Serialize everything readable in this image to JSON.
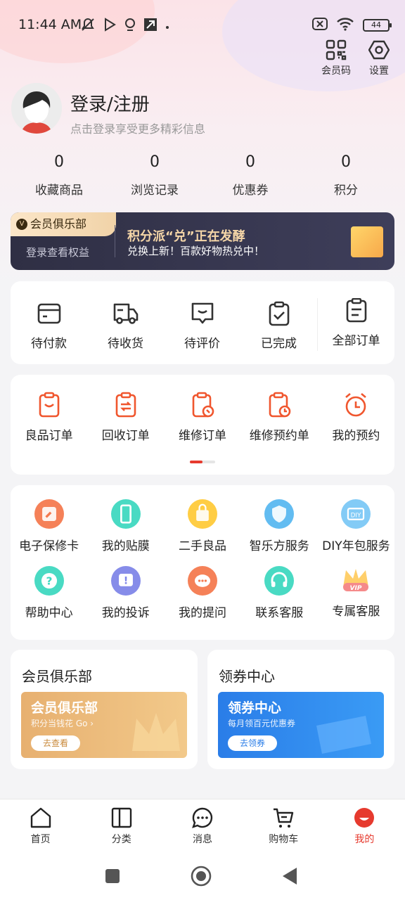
{
  "status": {
    "time": "11:44 AM",
    "battery": "44"
  },
  "top_buttons": {
    "member_code": "会员码",
    "settings": "设置"
  },
  "profile": {
    "title": "登录/注册",
    "subtitle": "点击登录享受更多精彩信息"
  },
  "stats": [
    {
      "value": "0",
      "label": "收藏商品"
    },
    {
      "value": "0",
      "label": "浏览记录"
    },
    {
      "value": "0",
      "label": "优惠券"
    },
    {
      "value": "0",
      "label": "积分"
    }
  ],
  "vip_banner": {
    "tag": "会员俱乐部",
    "see_benefits": "登录查看权益",
    "headline": "积分派“兑”正在发酵",
    "subline": "兑换上新！百款好物热兑中！"
  },
  "orders": [
    {
      "label": "待付款",
      "icon": "wallet-icon"
    },
    {
      "label": "待收货",
      "icon": "truck-icon"
    },
    {
      "label": "待评价",
      "icon": "comment-icon"
    },
    {
      "label": "已完成",
      "icon": "clipboard-check-icon"
    },
    {
      "label": "全部订单",
      "icon": "clipboard-list-icon"
    }
  ],
  "services": [
    {
      "label": "良品订单",
      "icon": "bag-order-icon"
    },
    {
      "label": "回收订单",
      "icon": "recycle-order-icon"
    },
    {
      "label": "维修订单",
      "icon": "repair-order-icon"
    },
    {
      "label": "维修预约单",
      "icon": "repair-booking-icon"
    },
    {
      "label": "我的预约",
      "icon": "alarm-clock-icon"
    }
  ],
  "tools_row1": [
    {
      "label": "电子保修卡",
      "icon": "wrench-card-icon",
      "color": "#f47a4f"
    },
    {
      "label": "我的贴膜",
      "icon": "phone-film-icon",
      "color": "#3fd8c0"
    },
    {
      "label": "二手良品",
      "icon": "shopping-bag-icon",
      "color": "#ffca3a"
    },
    {
      "label": "智乐方服务",
      "icon": "shield-icon",
      "color": "#5ab8f0"
    },
    {
      "label": "DIY年包服务",
      "icon": "diy-icon",
      "color": "#7cc8f5"
    }
  ],
  "tools_row2": [
    {
      "label": "帮助中心",
      "icon": "help-icon",
      "color": "#3fd8c0"
    },
    {
      "label": "我的投诉",
      "icon": "complaint-icon",
      "color": "#7f86e8"
    },
    {
      "label": "我的提问",
      "icon": "question-chat-icon",
      "color": "#f47a4f"
    },
    {
      "label": "联系客服",
      "icon": "headset-icon",
      "color": "#3fd8c0"
    },
    {
      "label": "专属客服",
      "icon": "vip-crown-icon",
      "color": "#f58a8a"
    }
  ],
  "bottom_cards": {
    "club": {
      "title": "会员俱乐部",
      "banner_title": "会员俱乐部",
      "banner_sub": "积分当钱花 Go ›",
      "button": "去查看"
    },
    "coupon": {
      "title": "领券中心",
      "banner_title": "领券中心",
      "banner_sub": "每月领百元优惠券",
      "button": "去领券"
    }
  },
  "nav": [
    {
      "label": "首页",
      "icon": "home-icon"
    },
    {
      "label": "分类",
      "icon": "category-icon"
    },
    {
      "label": "消息",
      "icon": "message-icon"
    },
    {
      "label": "购物车",
      "icon": "cart-icon"
    },
    {
      "label": "我的",
      "icon": "profile-icon"
    }
  ],
  "colors": {
    "accent": "#e63a2e",
    "orange_icon": "#f0562e"
  }
}
